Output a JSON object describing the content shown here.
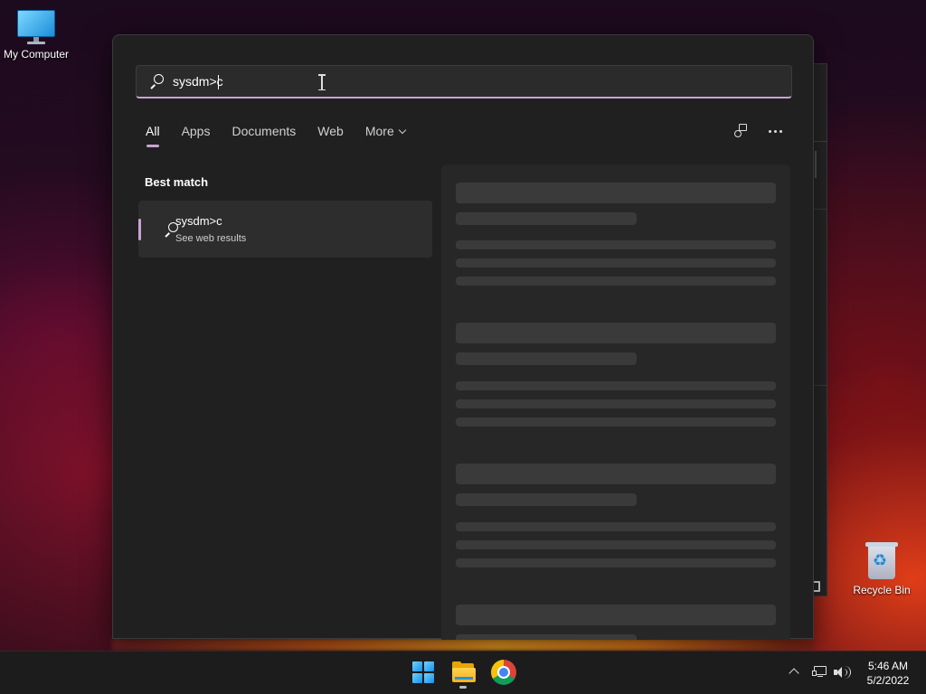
{
  "desktop": {
    "icons": [
      {
        "label": "My Computer",
        "icon": "monitor-icon"
      },
      {
        "label": "Recycle Bin",
        "icon": "recycle-bin-icon"
      }
    ]
  },
  "search": {
    "query": "sysdm>c",
    "tabs": [
      {
        "label": "All",
        "active": true
      },
      {
        "label": "Apps"
      },
      {
        "label": "Documents"
      },
      {
        "label": "Web"
      },
      {
        "label": "More"
      }
    ],
    "toolbar_icons": [
      "feedback-icon",
      "more-options-icon"
    ],
    "best_match": {
      "section_title": "Best match",
      "title": "sysdm>c",
      "subtitle": "See web results"
    },
    "accent_color": "#c9a3d4"
  },
  "taskbar": {
    "apps": [
      "start-button",
      "file-explorer",
      "google-chrome"
    ],
    "clock": {
      "time": "5:46 AM",
      "date": "5/2/2022"
    }
  }
}
